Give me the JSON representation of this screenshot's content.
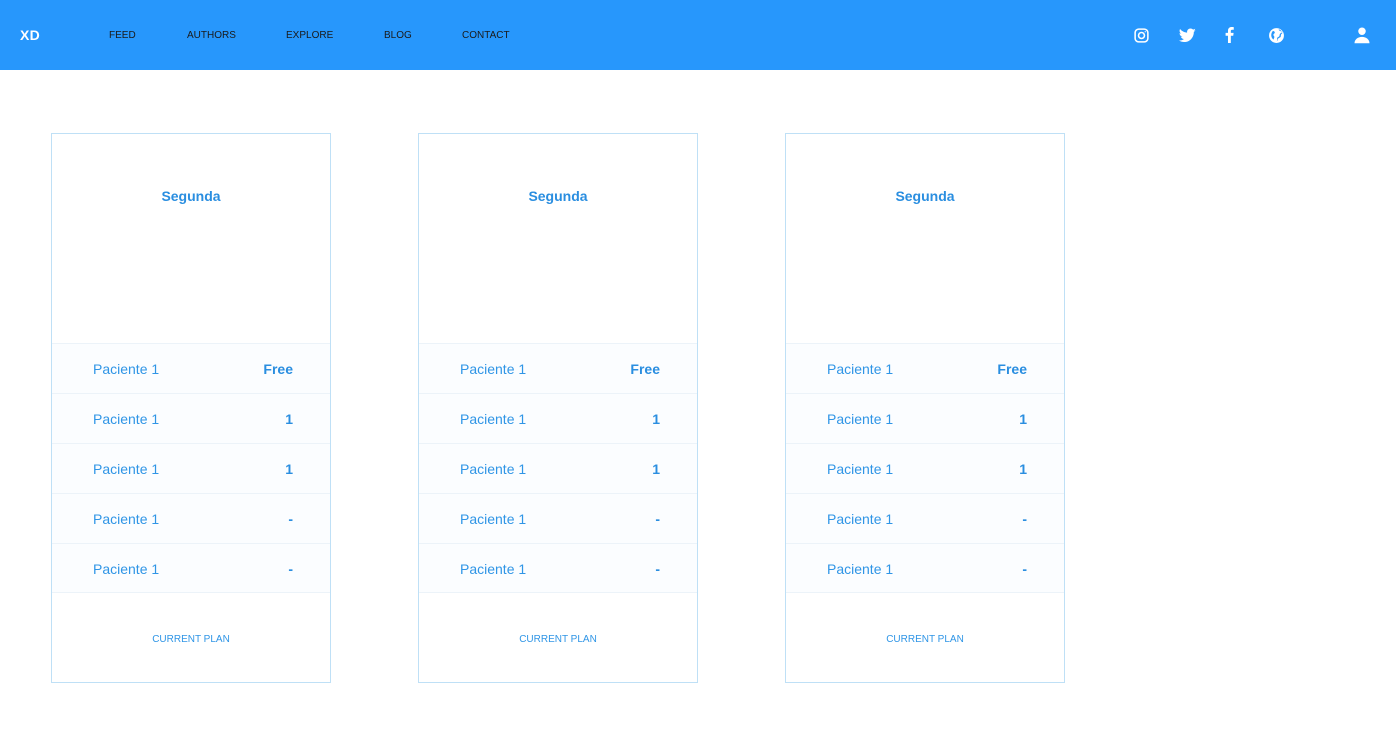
{
  "brand": "XD",
  "nav": [
    "FEED",
    "AUTHORS",
    "EXPLORE",
    "BLOG",
    "CONTACT"
  ],
  "header_icons": [
    "instagram-icon",
    "twitter-icon",
    "facebook-icon",
    "globe-icon",
    "user-icon"
  ],
  "colors": {
    "header": "#2797fc",
    "accent": "#2a8ee0",
    "card_border": "#bfe0f6"
  },
  "cards": [
    {
      "title": "Segunda",
      "rows": [
        {
          "label": "Paciente 1",
          "value": "Free"
        },
        {
          "label": "Paciente 1",
          "value": "1"
        },
        {
          "label": "Paciente 1",
          "value": "1"
        },
        {
          "label": "Paciente 1",
          "value": "-"
        },
        {
          "label": "Paciente 1",
          "value": "-"
        }
      ],
      "cta": "CURRENT PLAN"
    },
    {
      "title": "Segunda",
      "rows": [
        {
          "label": "Paciente 1",
          "value": "Free"
        },
        {
          "label": "Paciente 1",
          "value": "1"
        },
        {
          "label": "Paciente 1",
          "value": "1"
        },
        {
          "label": "Paciente 1",
          "value": "-"
        },
        {
          "label": "Paciente 1",
          "value": "-"
        }
      ],
      "cta": "CURRENT PLAN"
    },
    {
      "title": "Segunda",
      "rows": [
        {
          "label": "Paciente 1",
          "value": "Free"
        },
        {
          "label": "Paciente 1",
          "value": "1"
        },
        {
          "label": "Paciente 1",
          "value": "1"
        },
        {
          "label": "Paciente 1",
          "value": "-"
        },
        {
          "label": "Paciente 1",
          "value": "-"
        }
      ],
      "cta": "CURRENT PLAN"
    }
  ]
}
